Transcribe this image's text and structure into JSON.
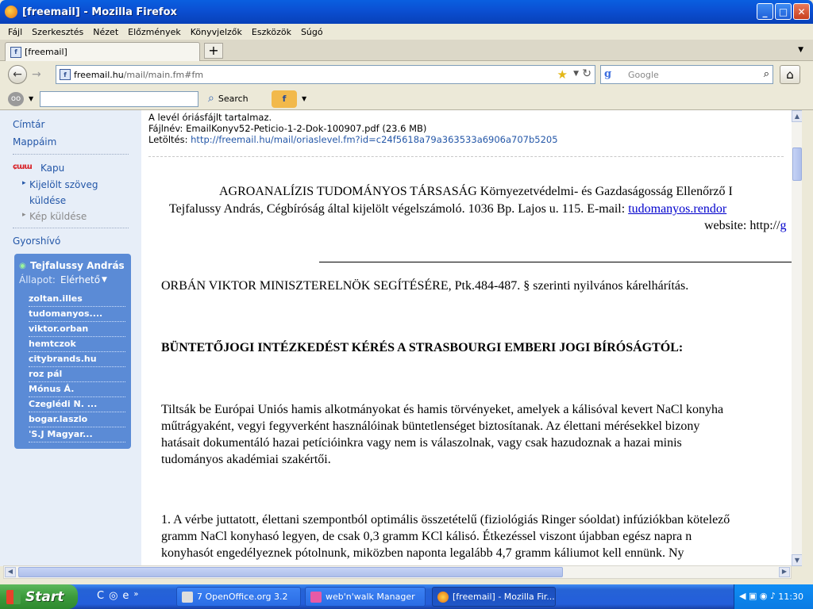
{
  "window": {
    "title": "[freemail] - Mozilla Firefox"
  },
  "menu": [
    "Fájl",
    "Szerkesztés",
    "Nézet",
    "Előzmények",
    "Könyvjelzők",
    "Eszközök",
    "Súgó"
  ],
  "tab": {
    "title": "[freemail]",
    "favicon": "f"
  },
  "nav": {
    "url_host": "freemail.hu",
    "url_path": "/mail/main.fm#fm",
    "search_placeholder": "Google"
  },
  "toolbar2": {
    "search_label": "Search"
  },
  "sidebar": {
    "cimtar": "Címtár",
    "mappaim": "Mappáim",
    "kapu_logo": "ɕɯɯ",
    "kapu": "Kapu",
    "kijelolt_1": "Kijelölt szöveg",
    "kijelolt_2": "küldése",
    "kep": "Kép küldése",
    "gyorshivo": "Gyorshívó",
    "contact_name": "Tejfalussy András",
    "status_label": "Állapot:",
    "status_value": "Elérhető",
    "contacts": [
      "zoltan.illes",
      "tudomanyos....",
      "viktor.orban",
      "hemtczok",
      "citybrands.hu",
      "roz pál",
      "Mónus Á.",
      "Czeglédi N. ...",
      "bogar.laszlo",
      "'S.J Magyar..."
    ]
  },
  "attachment": {
    "line1": "A levél óriásfájlt tartalmaz.",
    "line2": "Fájlnév: EmailKonyv52-Peticio-1-2-Dok-100907.pdf (23.6 MB)",
    "link_label": "Letöltés:",
    "link": "http://freemail.hu/mail/oriaslevel.fm?id=c24f5618a79a363533a6906a707b5205"
  },
  "doc": {
    "header1": "AGROANALÍZIS TUDOMÁNYOS TÁRSASÁG Környezetvédelmi- és Gazdaságosság Ellenőrző I",
    "header2": "Tejfalussy András, Cégbíróság által kijelölt végelszámoló. 1036 Bp. Lajos u. 115. E-mail:",
    "header2_link": "tudomanyos.rendor",
    "header3": "website: http://",
    "header3_link": "g",
    "p1": "ORBÁN VIKTOR MINISZTERELNÖK SEGÍTÉSÉRE, Ptk.484-487. § szerinti nyilvános kárelhárítás.",
    "p2": "BÜNTETŐJOGI INTÉZKEDÉST KÉRÉS A STRASBOURGI EMBERI JOGI BÍRÓSÁGTÓL:",
    "p3_l1": "Tiltsák be Európai Uniós hamis alkotmányokat és hamis törvényeket, amelyek a kálisóval kevert NaCl konyha",
    "p3_l2": "műtrágyaként, vegyi fegyverként használóinak büntetlenséget biztosítanak. Az élettani mérésekkel bizony",
    "p3_l3": "hatásait dokumentáló hazai petícióinkra vagy nem is válaszolnak, vagy csak hazudoznak a hazai minis",
    "p3_l4": "tudományos akadémiai szakértői.",
    "p4_l1": "1. A vérbe juttatott, élettani szempontból optimális összetételű (fiziológiás Ringer sóoldat) infúziókban kötelező",
    "p4_l2": "gramm NaCl konyhasó legyen, de csak 0,3 gramm KCl kálisó. Étkezéssel viszont újabban egész napra n",
    "p4_l3": "konyhasót engedélyeznek pótolnunk, miközben naponta legalább 4,7 gramm káliumot kell ennünk. Ny"
  },
  "taskbar": {
    "start": "Start",
    "tasks": [
      "7 OpenOffice.org 3.2",
      "web'n'walk Manager",
      "[freemail] - Mozilla Fir..."
    ],
    "clock": "11:30"
  }
}
